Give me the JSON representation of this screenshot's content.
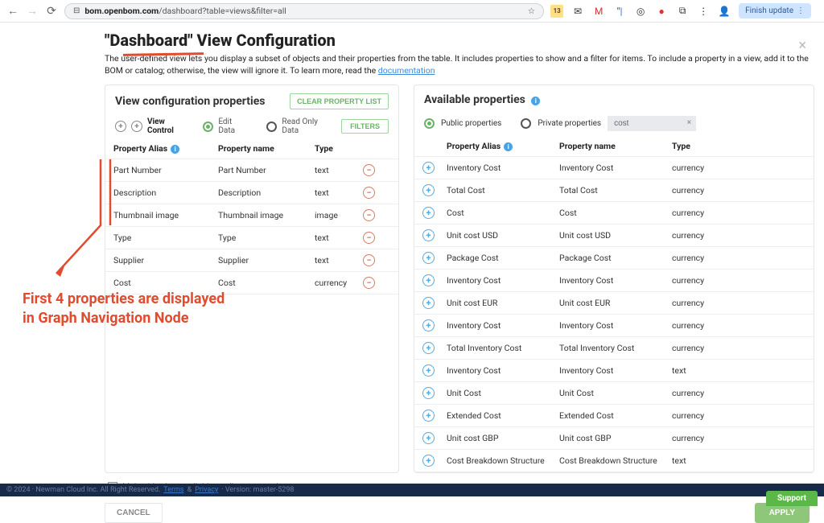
{
  "browser": {
    "url_host": "bom.openbom.com",
    "url_path": "/dashboard?table=views&filter=all",
    "star": "☆",
    "finish_update": "Finish update"
  },
  "modal": {
    "title": "\"Dashboard\" View Configuration",
    "subtext": "The user-defined view lets you display a subset of objects and their properties from the table. It includes properties to show and a filter for items. To include a property in a view, add it to the BOM or catalog; otherwise, the view will ignore it. To learn more, read the ",
    "doc_link": "documentation",
    "left": {
      "title": "View configuration properties",
      "clear_btn": "CLEAR PROPERTY LIST",
      "view_control": "View Control",
      "edit_data": "Edit Data",
      "read_only": "Read Only Data",
      "filters_btn": "FILTERS",
      "cols": {
        "alias": "Property Alias",
        "name": "Property name",
        "type": "Type"
      },
      "rows": [
        {
          "alias": "Part Number",
          "name": "Part Number",
          "type": "text"
        },
        {
          "alias": "Description",
          "name": "Description",
          "type": "text"
        },
        {
          "alias": "Thumbnail image",
          "name": "Thumbnail image",
          "type": "image"
        },
        {
          "alias": "Type",
          "name": "Type",
          "type": "text"
        },
        {
          "alias": "Supplier",
          "name": "Supplier",
          "type": "text"
        },
        {
          "alias": "Cost",
          "name": "Cost",
          "type": "currency"
        }
      ]
    },
    "right": {
      "title": "Available properties",
      "public_props": "Public properties",
      "private_props": "Private properties",
      "search_value": "cost",
      "cols": {
        "alias": "Property Alias",
        "name": "Property name",
        "type": "Type"
      },
      "rows": [
        {
          "alias": "Inventory Cost",
          "name": "Inventory Cost",
          "type": "currency"
        },
        {
          "alias": "Total Cost",
          "name": "Total Cost",
          "type": "currency"
        },
        {
          "alias": "Cost",
          "name": "Cost",
          "type": "currency"
        },
        {
          "alias": "Unit cost USD",
          "name": "Unit cost USD",
          "type": "currency"
        },
        {
          "alias": "Package Cost",
          "name": "Package Cost",
          "type": "currency"
        },
        {
          "alias": "Inventory Cost",
          "name": "Inventory Cost",
          "type": "currency"
        },
        {
          "alias": "Unit cost EUR",
          "name": "Unit cost EUR",
          "type": "currency"
        },
        {
          "alias": "Inventory Cost",
          "name": "Inventory Cost",
          "type": "currency"
        },
        {
          "alias": "Total Inventory Cost",
          "name": "Total Inventory Cost",
          "type": "currency"
        },
        {
          "alias": "Inventory Cost",
          "name": "Inventory Cost",
          "type": "text"
        },
        {
          "alias": "Unit Cost",
          "name": "Unit Cost",
          "type": "currency"
        },
        {
          "alias": "Extended Cost",
          "name": "Extended Cost",
          "type": "currency"
        },
        {
          "alias": "Unit cost GBP",
          "name": "Unit cost GBP",
          "type": "currency"
        },
        {
          "alias": "Cost Breakdown Structure",
          "name": "Cost Breakdown Structure",
          "type": "text"
        }
      ]
    },
    "team_checkbox": "Make this view available to all team members",
    "cancel": "CANCEL",
    "apply": "APPLY"
  },
  "annotation": "First 4 properties are displayed\nin Graph Navigation Node",
  "footer": {
    "copy": "© 2024 · Newman Cloud Inc. All Right Reserved. ",
    "terms": "Terms",
    "amp": " & ",
    "privacy": "Privacy",
    "version": " · Version: master-5298",
    "support": "Support"
  }
}
